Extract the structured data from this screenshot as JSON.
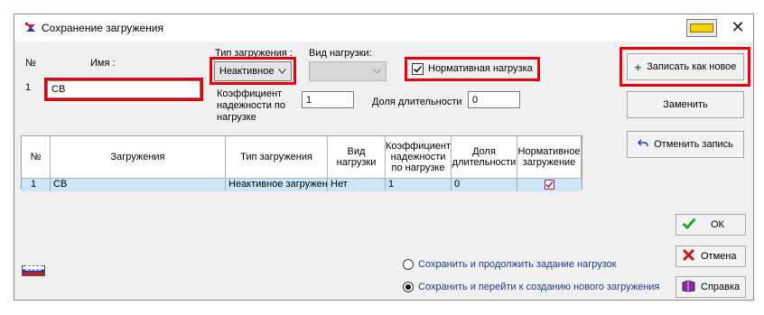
{
  "window": {
    "title": "Сохранение загружения"
  },
  "form": {
    "num_label": "№",
    "num_value": "1",
    "name_label": "Имя :",
    "name_value": "СВ",
    "load_type_label": "Тип загружения :",
    "load_type_value": "Неактивное",
    "load_kind_label": "Вид нагрузки:",
    "load_kind_value": "",
    "normative_label": "Нормативная нагрузка",
    "normative_checked": true,
    "coef_label_1": "Коэффициент",
    "coef_label_2": "надежности по",
    "coef_label_3": "нагрузке",
    "coef_value": "1",
    "duration_label": "Доля длительности",
    "duration_value": "0"
  },
  "buttons": {
    "save_new": "Записать как новое",
    "replace": "Заменить",
    "cancel_record": "Отменить запись",
    "ok": "ОК",
    "cancel": "Отмена",
    "help": "Справка"
  },
  "table": {
    "headers": {
      "num": "№",
      "load": "Загружения",
      "type": "Тип загружения",
      "kind_1": "Вид",
      "kind_2": "нагрузки",
      "coef_1": "Коэффициент",
      "coef_2": "надежности",
      "coef_3": "по нагрузке",
      "dur_1": "Доля",
      "dur_2": "длительности",
      "norm_1": "Нормативное",
      "norm_2": "загружение"
    },
    "rows": [
      {
        "num": "1",
        "load": "СВ",
        "type": "Неактивное загружение",
        "kind": "Нет",
        "coef": "1",
        "dur": "0",
        "norm": true
      }
    ]
  },
  "options": {
    "continue_label": "Сохранить и продолжить задание нагрузок",
    "new_label": "Сохранить и перейти к созданию нового загружения",
    "selected": "new"
  },
  "badge": {
    "year": "2016"
  },
  "colors": {
    "highlight": "#e8000b",
    "selection": "#cde6f7",
    "radio_text": "#1a3a8a"
  }
}
